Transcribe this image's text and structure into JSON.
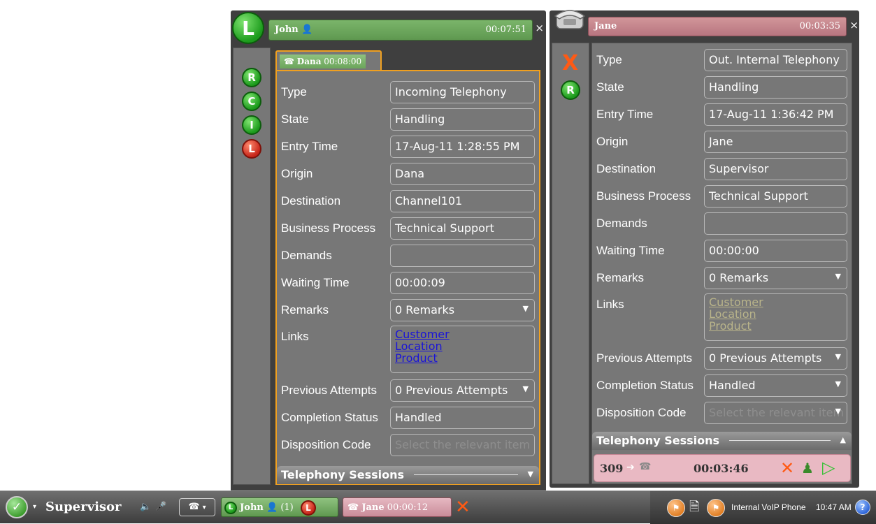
{
  "left_window": {
    "title_name": "John",
    "title_time": "00:07:51",
    "close_label": "×",
    "big_badge": "L",
    "sidebar_buttons": [
      "R",
      "C",
      "I",
      "L"
    ],
    "tab": {
      "name": "Dana",
      "time": "00:08:00"
    },
    "fields": {
      "type": {
        "label": "Type",
        "value": "Incoming Telephony"
      },
      "state": {
        "label": "State",
        "value": "Handling"
      },
      "entry_time": {
        "label": "Entry Time",
        "value": "17-Aug-11 1:28:55 PM"
      },
      "origin": {
        "label": "Origin",
        "value": "Dana"
      },
      "destination": {
        "label": "Destination",
        "value": "Channel101"
      },
      "business_process": {
        "label": "Business Process",
        "value": "Technical Support"
      },
      "demands": {
        "label": "Demands",
        "value": ""
      },
      "waiting_time": {
        "label": "Waiting Time",
        "value": "00:00:09"
      },
      "remarks": {
        "label": "Remarks",
        "value": "0 Remarks"
      },
      "links": {
        "label": "Links",
        "items": [
          "Customer",
          "Location",
          "Product"
        ]
      },
      "previous_attempts": {
        "label": "Previous Attempts",
        "value": "0 Previous Attempts"
      },
      "completion_status": {
        "label": "Completion Status",
        "value": "Handled"
      },
      "disposition_code": {
        "label": "Disposition Code",
        "placeholder": "Select the relevant item"
      }
    },
    "section_title": "Telephony Sessions"
  },
  "right_window": {
    "title_name": "Jane",
    "title_time": "00:03:35",
    "close_label": "×",
    "sidebar_buttons": [
      "X",
      "R"
    ],
    "fields": {
      "type": {
        "label": "Type",
        "value": "Out. Internal Telephony"
      },
      "state": {
        "label": "State",
        "value": "Handling"
      },
      "entry_time": {
        "label": "Entry Time",
        "value": "17-Aug-11 1:36:42 PM"
      },
      "origin": {
        "label": "Origin",
        "value": "Jane"
      },
      "destination": {
        "label": "Destination",
        "value": "Supervisor"
      },
      "business_process": {
        "label": "Business Process",
        "value": "Technical Support"
      },
      "demands": {
        "label": "Demands",
        "value": ""
      },
      "waiting_time": {
        "label": "Waiting Time",
        "value": "00:00:00"
      },
      "remarks": {
        "label": "Remarks",
        "value": "0 Remarks"
      },
      "links": {
        "label": "Links",
        "items": [
          "Customer",
          "Location",
          "Product"
        ]
      },
      "previous_attempts": {
        "label": "Previous Attempts",
        "value": "0 Previous Attempts"
      },
      "completion_status": {
        "label": "Completion Status",
        "value": "Handled"
      },
      "disposition_code": {
        "label": "Disposition Code",
        "placeholder": "Select the relevant item"
      }
    },
    "section_title": "Telephony Sessions",
    "session": {
      "number": "309",
      "time": "00:03:46"
    }
  },
  "taskbar": {
    "user_label": "Supervisor",
    "item_john": {
      "name": "John",
      "count": "(1)"
    },
    "item_jane": {
      "name": "Jane",
      "time": "00:00:12"
    },
    "phone_label": "Internal VoIP Phone",
    "clock": "10:47 AM",
    "help_label": "?"
  },
  "colors": {
    "green_badge": "#1c9b1c",
    "red_badge": "#c7261a",
    "active_border": "#f0a020",
    "link_active": "#1a14d8",
    "link_disabled": "#b9b48a",
    "panel_bg": "#777777"
  }
}
